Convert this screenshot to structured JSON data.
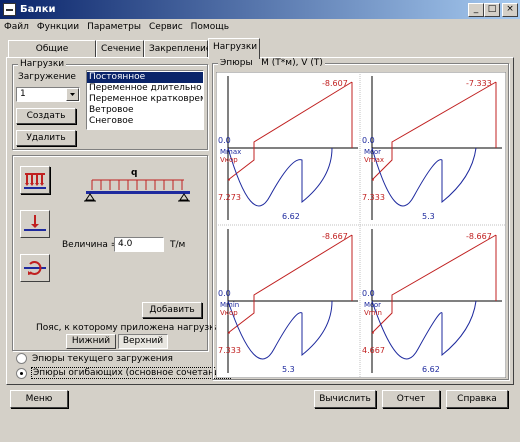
{
  "window": {
    "title": "Балки"
  },
  "menu": [
    "Файл",
    "Функции",
    "Параметры",
    "Сервис",
    "Помощь"
  ],
  "tabs": [
    "Общие параметры",
    "Сечение",
    "Закрепление",
    "Нагрузки"
  ],
  "active_tab": "Нагрузки",
  "loads": {
    "group_title": "Нагрузки",
    "loading_label": "Загружение",
    "loading_value": "1",
    "create_button": "Создать",
    "delete_button": "Удалить",
    "types": [
      "Постоянное",
      "Переменное длительно дей",
      "Переменное кратковремен",
      "Ветровое",
      "Снеговое"
    ],
    "selected_type": "Постоянное"
  },
  "load_params": {
    "beam_label": "q",
    "magnitude_label": "Величина =",
    "magnitude_value": "4.0",
    "magnitude_unit": "Т/м",
    "add_button": "Добавить",
    "belt_caption": "Пояс, к которому приложена нагрузка",
    "belt_lower": "Нижний",
    "belt_upper": "Верхний"
  },
  "diagram_options": {
    "current": "Эпюры текущего загружения",
    "envelope": "Эпюры огибающих (основное сочетание)",
    "selected": "envelope"
  },
  "plots": {
    "title": "Эпюры   M (Т*м), V (Т)",
    "panels": [
      {
        "top_value": "-8.607",
        "left_value": "7.273",
        "bottom_value": "6.62",
        "zero": "0.0",
        "m_label": "Mmax",
        "v_label": "Vкор"
      },
      {
        "top_value": "-7.333",
        "left_value": "7.333",
        "bottom_value": "5.3",
        "zero": "0.0",
        "m_label": "Mcor",
        "v_label": "Vmax"
      },
      {
        "top_value": "-8.667",
        "left_value": "7.333",
        "bottom_value": "5.3",
        "zero": "0.0",
        "m_label": "Mmin",
        "v_label": "Vкор"
      },
      {
        "top_value": "-8.667",
        "left_value": "4.667",
        "bottom_value": "6.62",
        "zero": "0.0",
        "m_label": "Mcor",
        "v_label": "Vmin"
      }
    ]
  },
  "footer": {
    "menu": "Меню",
    "compute": "Вычислить",
    "report": "Отчет",
    "help": "Справка"
  },
  "colors": {
    "moment": "#1e2a9e",
    "shear": "#c02020",
    "titlebar": "#0a246a"
  }
}
